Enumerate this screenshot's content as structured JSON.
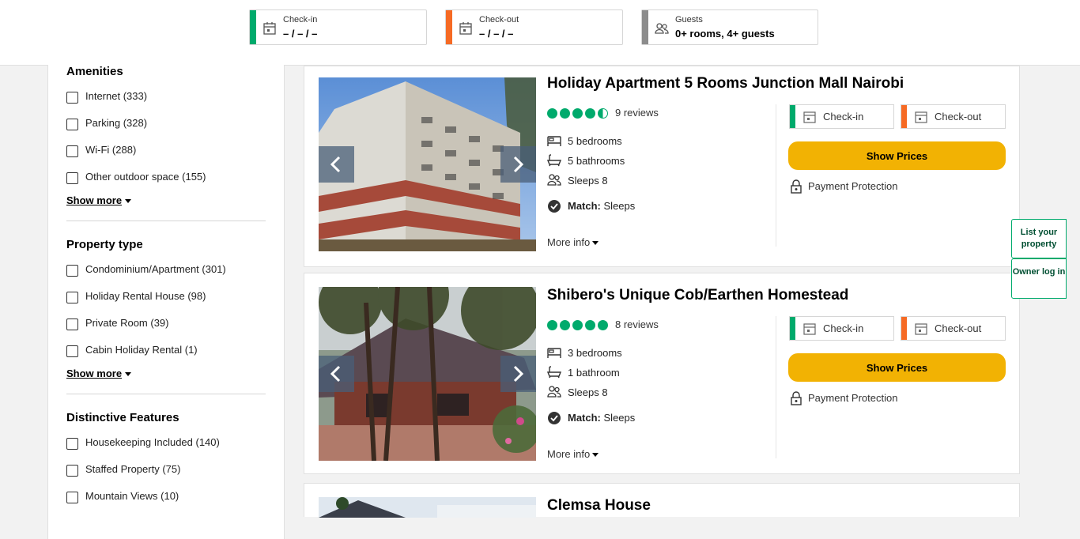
{
  "search": {
    "checkin": {
      "label": "Check-in",
      "value": "– / – / –",
      "color": "#00aa6c"
    },
    "checkout": {
      "label": "Check-out",
      "value": "– / – / –",
      "color": "#f66a24"
    },
    "guests": {
      "label": "Guests",
      "value": "0+ rooms, 4+ guests",
      "color": "#8c8c8c"
    }
  },
  "sidebar": {
    "amenities": {
      "title": "Amenities",
      "items": [
        "Internet (333)",
        "Parking (328)",
        "Wi-Fi (288)",
        "Other outdoor space (155)"
      ],
      "show_more": "Show more"
    },
    "property_type": {
      "title": "Property type",
      "items": [
        "Condominium/Apartment (301)",
        "Holiday Rental House (98)",
        "Private Room (39)",
        "Cabin Holiday Rental (1)"
      ],
      "show_more": "Show more"
    },
    "features": {
      "title": "Distinctive Features",
      "items": [
        "Housekeeping Included (140)",
        "Staffed Property (75)",
        "Mountain Views (10)"
      ]
    }
  },
  "listings": [
    {
      "title": "Holiday Apartment 5 Rooms Junction Mall Nairobi",
      "rating": 4.5,
      "reviews": "9 reviews",
      "bedrooms": "5 bedrooms",
      "bathrooms": "5 bathrooms",
      "sleeps": "Sleeps 8",
      "match_label": "Match:",
      "match_value": "Sleeps",
      "more_info": "More info",
      "checkin": "Check-in",
      "checkout": "Check-out",
      "show_prices": "Show Prices",
      "protection": "Payment Protection"
    },
    {
      "title": "Shibero's Unique Cob/Earthen Homestead",
      "rating": 5,
      "reviews": "8 reviews",
      "bedrooms": "3 bedrooms",
      "bathrooms": "1 bathroom",
      "sleeps": "Sleeps 8",
      "match_label": "Match:",
      "match_value": "Sleeps",
      "more_info": "More info",
      "checkin": "Check-in",
      "checkout": "Check-out",
      "show_prices": "Show Prices",
      "protection": "Payment Protection"
    },
    {
      "title": "Clemsa House"
    }
  ],
  "side_buttons": {
    "list_property": "List your property",
    "owner_login": "Owner log in"
  },
  "icons": {
    "calendar": "calendar-icon",
    "guests": "people-icon",
    "bed": "bed-icon",
    "bath": "bathtub-icon",
    "sleeps": "people-icon",
    "match": "check-circle-icon",
    "protection": "lock-icon"
  }
}
